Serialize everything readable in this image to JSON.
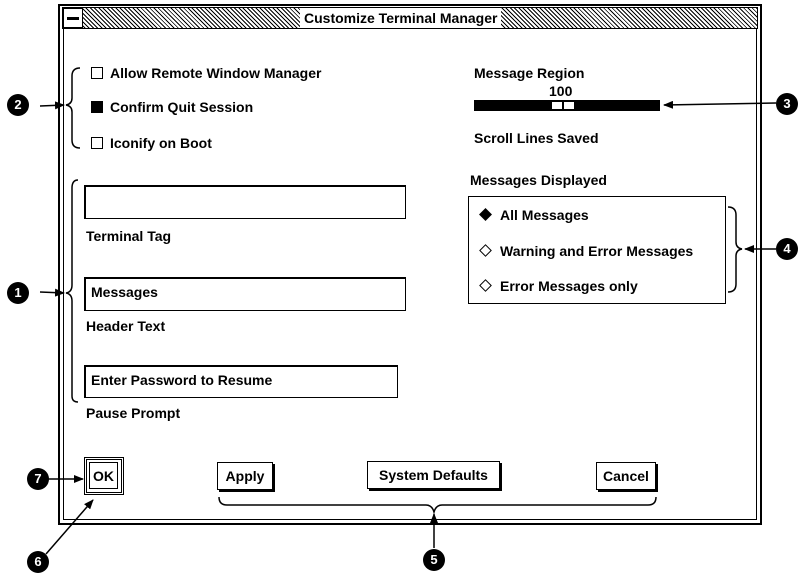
{
  "window": {
    "title": "Customize Terminal Manager"
  },
  "options": {
    "allow_remote": {
      "label": "Allow Remote Window Manager",
      "checked": false
    },
    "confirm_quit": {
      "label": "Confirm Quit Session",
      "checked": true
    },
    "iconify_boot": {
      "label": "Iconify on Boot",
      "checked": false
    }
  },
  "fields": {
    "terminal_tag": {
      "value": "",
      "label": "Terminal Tag"
    },
    "header_text": {
      "value": "Messages",
      "label": "Header Text"
    },
    "pause_prompt": {
      "value": "Enter Password to Resume",
      "label": "Pause Prompt"
    }
  },
  "scroll": {
    "title": "Message Region",
    "value": "100",
    "label": "Scroll Lines Saved"
  },
  "messages": {
    "heading": "Messages Displayed",
    "options": [
      "All Messages",
      "Warning and Error Messages",
      "Error Messages only"
    ],
    "selected": "All Messages"
  },
  "buttons": {
    "ok": "OK",
    "apply": "Apply",
    "defaults": "System Defaults",
    "cancel": "Cancel"
  },
  "callouts": [
    "1",
    "2",
    "3",
    "4",
    "5",
    "6",
    "7"
  ]
}
